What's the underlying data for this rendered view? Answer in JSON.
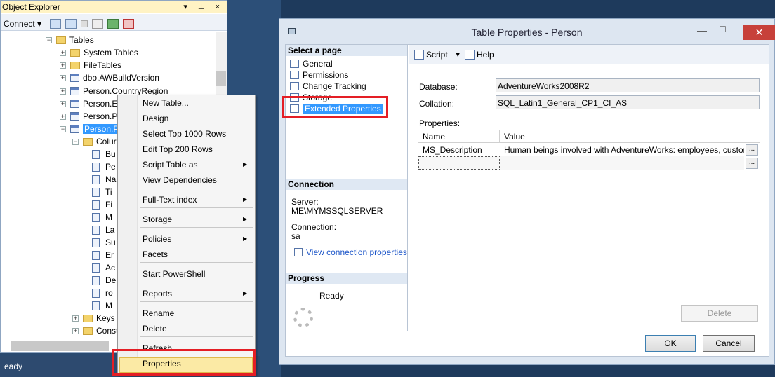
{
  "object_explorer": {
    "title": "Object Explorer",
    "title_buttons": "▾ ⊥ ×",
    "connect_label": "Connect ▾",
    "tree": [
      {
        "label": "Tables",
        "type": "folder",
        "expander": "−"
      },
      {
        "label": "System Tables",
        "type": "folder",
        "expander": "+"
      },
      {
        "label": "FileTables",
        "type": "folder",
        "expander": "+"
      },
      {
        "label": "dbo.AWBuildVersion",
        "type": "table",
        "expander": "+"
      },
      {
        "label": "Person.CountryRegion",
        "type": "table",
        "expander": "+"
      },
      {
        "label": "Person.Er",
        "type": "table",
        "expander": "+"
      },
      {
        "label": "Person.Pa",
        "type": "table",
        "expander": "+"
      },
      {
        "label": "Person.Pe",
        "type": "table",
        "expander": "−",
        "selected": true
      },
      {
        "label": "Colur",
        "type": "folder",
        "expander": "−"
      },
      {
        "label": "Bu",
        "type": "column"
      },
      {
        "label": "Pe",
        "type": "column"
      },
      {
        "label": "Na",
        "type": "column"
      },
      {
        "label": "Ti",
        "type": "column"
      },
      {
        "label": "Fi",
        "type": "column"
      },
      {
        "label": "M",
        "type": "column"
      },
      {
        "label": "La",
        "type": "column"
      },
      {
        "label": "Su",
        "type": "column"
      },
      {
        "label": "Er",
        "type": "column"
      },
      {
        "label": "Ac",
        "type": "column"
      },
      {
        "label": "De",
        "type": "column"
      },
      {
        "label": "ro",
        "type": "column"
      },
      {
        "label": "M",
        "type": "column"
      },
      {
        "label": "Keys",
        "type": "folder",
        "expander": "+"
      },
      {
        "label": "Const",
        "type": "folder",
        "expander": "+"
      }
    ]
  },
  "context_menu": {
    "items": [
      {
        "label": "New Table..."
      },
      {
        "label": "Design"
      },
      {
        "label": "Select Top 1000 Rows"
      },
      {
        "label": "Edit Top 200 Rows"
      },
      {
        "label": "Script Table as",
        "submenu": "▶"
      },
      {
        "label": "View Dependencies"
      },
      {
        "label": "Full-Text index",
        "submenu": "▶"
      },
      {
        "label": "Storage",
        "submenu": "▶"
      },
      {
        "label": "Policies",
        "submenu": "▶"
      },
      {
        "label": "Facets"
      },
      {
        "label": "Start PowerShell"
      },
      {
        "label": "Reports",
        "submenu": "▶"
      },
      {
        "label": "Rename"
      },
      {
        "label": "Delete"
      },
      {
        "label": "Refresh"
      },
      {
        "label": "Properties",
        "highlighted": true
      }
    ]
  },
  "status_text": "eady",
  "dialog": {
    "title": "Table Properties - Person",
    "close": "✕",
    "minimize": "—",
    "maximize": "☐",
    "select_page_header": "Select a page",
    "pages": [
      {
        "label": "General"
      },
      {
        "label": "Permissions"
      },
      {
        "label": "Change Tracking"
      },
      {
        "label": "Storage"
      },
      {
        "label": "Extended Properties",
        "selected": true
      }
    ],
    "connection_header": "Connection",
    "server_label": "Server:",
    "server_value": "ME\\MYMSSQLSERVER",
    "connection_label": "Connection:",
    "connection_value": "sa",
    "view_connection_link": "View connection properties",
    "progress_header": "Progress",
    "progress_status": "Ready",
    "toolbar": {
      "script_label": "Script",
      "script_dropdown": "▼",
      "help_label": "Help"
    },
    "database_label": "Database:",
    "database_value": "AdventureWorks2008R2",
    "collation_label": "Collation:",
    "collation_value": "SQL_Latin1_General_CP1_CI_AS",
    "properties_label": "Properties:",
    "grid": {
      "columns": [
        "Name",
        "Value"
      ],
      "rows": [
        {
          "name": "MS_Description",
          "value": "Human beings involved with AdventureWorks: employees, customer ..."
        },
        {
          "name": "",
          "value": ""
        }
      ],
      "ellipsis": "..."
    },
    "delete_button": "Delete",
    "ok_button": "OK",
    "cancel_button": "Cancel"
  },
  "colors": {
    "highlight": "#3399ff",
    "red_box": "#e41e25",
    "menu_hover": "#fbeaa5"
  }
}
